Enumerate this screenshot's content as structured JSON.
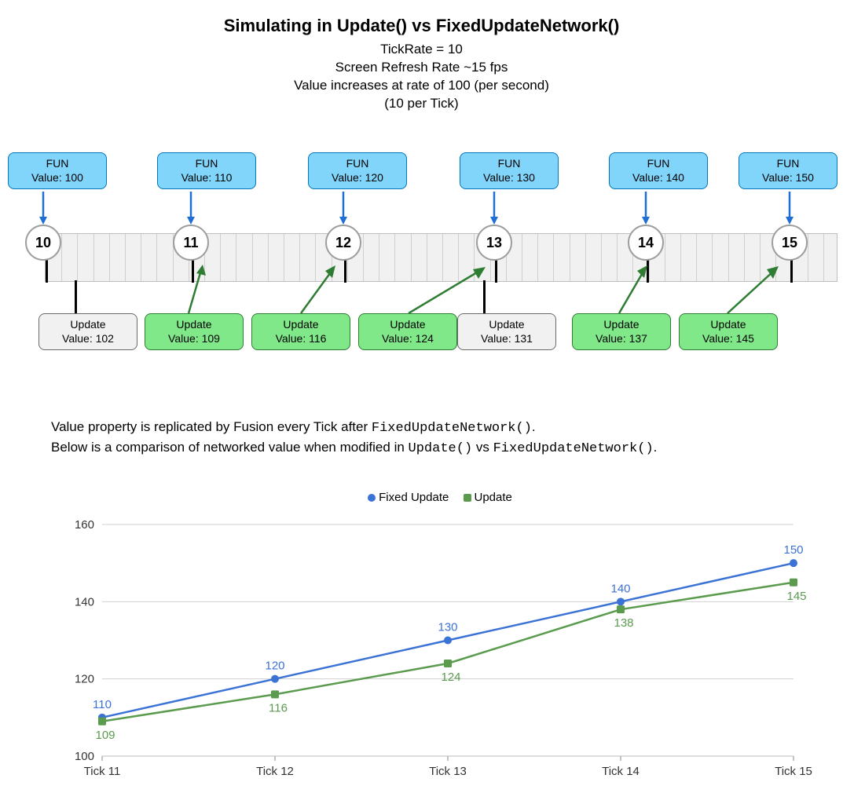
{
  "title": "Simulating in Update() vs FixedUpdateNetwork()",
  "subtitle": {
    "l1": "TickRate = 10",
    "l2": "Screen Refresh Rate ~15 fps",
    "l3": "Value increases at rate of 100 (per second)",
    "l4": "(10 per Tick)"
  },
  "timeline": {
    "fun_boxes": [
      {
        "line1": "FUN",
        "line2": "Value: 100"
      },
      {
        "line1": "FUN",
        "line2": "Value: 110"
      },
      {
        "line1": "FUN",
        "line2": "Value: 120"
      },
      {
        "line1": "FUN",
        "line2": "Value: 130"
      },
      {
        "line1": "FUN",
        "line2": "Value: 140"
      },
      {
        "line1": "FUN",
        "line2": "Value: 150"
      }
    ],
    "tick_labels": [
      "10",
      "11",
      "12",
      "13",
      "14",
      "15"
    ],
    "upd_boxes": [
      {
        "line1": "Update",
        "line2": "Value: 102",
        "green": false
      },
      {
        "line1": "Update",
        "line2": "Value: 109",
        "green": true
      },
      {
        "line1": "Update",
        "line2": "Value: 116",
        "green": true
      },
      {
        "line1": "Update",
        "line2": "Value: 124",
        "green": true
      },
      {
        "line1": "Update",
        "line2": "Value: 131",
        "green": false
      },
      {
        "line1": "Update",
        "line2": "Value: 137",
        "green": true
      },
      {
        "line1": "Update",
        "line2": "Value: 145",
        "green": true
      }
    ]
  },
  "explain": {
    "p1a": "Value property is replicated by Fusion every Tick after ",
    "p1b": "FixedUpdateNetwork()",
    "p1c": ".",
    "p2a": "Below is a comparison of networked value when modified in ",
    "p2b": "Update()",
    "p2c": " vs ",
    "p2d": "FixedUpdateNetwork()",
    "p2e": "."
  },
  "chart_data": {
    "type": "line",
    "title": "",
    "legend": [
      "Fixed Update",
      "Update"
    ],
    "xlabel": "",
    "ylabel": "",
    "categories": [
      "Tick 11",
      "Tick 12",
      "Tick 13",
      "Tick 14",
      "Tick 15"
    ],
    "series": [
      {
        "name": "Fixed Update",
        "values": [
          110,
          120,
          130,
          140,
          150
        ],
        "color": "#3b72d6",
        "marker": "circle"
      },
      {
        "name": "Update",
        "values": [
          109,
          116,
          124,
          138,
          145
        ],
        "color": "#5a9b4e",
        "marker": "square"
      }
    ],
    "ylim": [
      100,
      160
    ],
    "yticks": [
      100,
      120,
      140,
      160
    ]
  },
  "legend_labels": {
    "a": "Fixed Update",
    "b": "Update"
  }
}
